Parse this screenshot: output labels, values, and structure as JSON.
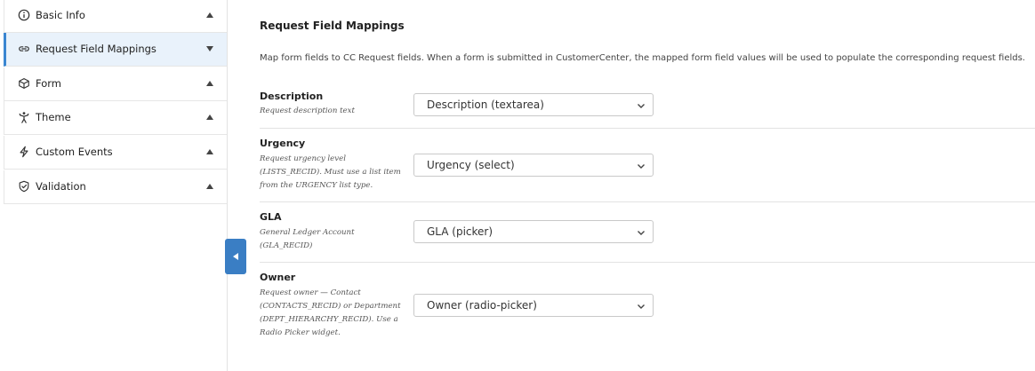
{
  "sidebar": {
    "items": [
      {
        "label": "Basic Info",
        "icon": "info-icon",
        "chevron": "up"
      },
      {
        "label": "Request Field Mappings",
        "icon": "link-icon",
        "chevron": "down"
      },
      {
        "label": "Form",
        "icon": "cube-icon",
        "chevron": "up"
      },
      {
        "label": "Theme",
        "icon": "theme-icon",
        "chevron": "up"
      },
      {
        "label": "Custom Events",
        "icon": "lightning-icon",
        "chevron": "up"
      },
      {
        "label": "Validation",
        "icon": "shield-check-icon",
        "chevron": "up"
      }
    ],
    "active_index": 1
  },
  "main": {
    "title": "Request Field Mappings",
    "description": "Map form fields to CC Request fields. When a form is submitted in CustomerCenter, the mapped form field values will be used to populate the corresponding request fields.",
    "fields": [
      {
        "label": "Description",
        "help": "Request description text",
        "value": "Description (textarea)"
      },
      {
        "label": "Urgency",
        "help": "Request urgency level (LISTS_RECID). Must use a list item from the URGENCY list type.",
        "value": "Urgency (select)"
      },
      {
        "label": "GLA",
        "help": "General Ledger Account (GLA_RECID)",
        "value": "GLA (picker)"
      },
      {
        "label": "Owner",
        "help": "Request owner — Contact (CONTACTS_RECID) or Department (DEPT_HIERARCHY_RECID). Use a Radio Picker widget.",
        "value": "Owner (radio-picker)"
      }
    ]
  },
  "colors": {
    "accent": "#3a7ec4",
    "active_bg": "#e9f2fb"
  }
}
